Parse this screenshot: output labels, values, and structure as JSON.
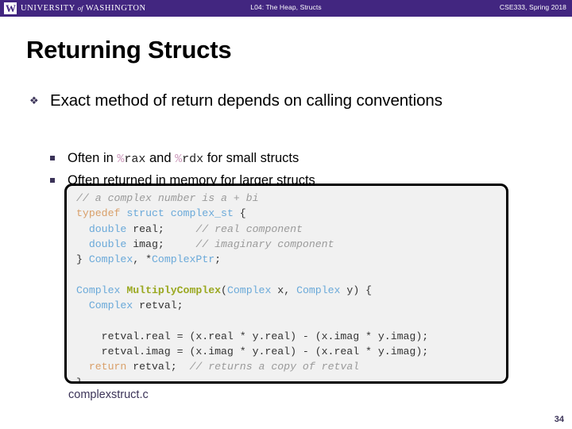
{
  "header": {
    "logo_mark": "W",
    "logo_word_1": "UNIVERSITY",
    "logo_word_of": "of",
    "logo_word_2": "WASHINGTON",
    "center_title": "L04: The Heap, Structs",
    "right_title": "CSE333, Spring 2018",
    "bar_color": "#422680"
  },
  "slide": {
    "title": "Returning Structs",
    "page_number": "34",
    "accent_color": "#3b3358",
    "bullets": [
      {
        "marker": "diamond-bullet",
        "text": "Exact method of return depends on calling conventions"
      }
    ],
    "sub_bullets": [
      {
        "marker": "square-bullet",
        "prefix": "Often in ",
        "code_1_pct": "%",
        "code_1": "rax",
        "middle": " and ",
        "code_2_pct": "%",
        "code_2": "rdx",
        "suffix": " for small structs",
        "plain": "Often in %rax and %rdx for small structs"
      },
      {
        "marker": "square-bullet",
        "plain": "Often returned in memory for larger structs"
      }
    ],
    "caption": "complexstruct.c"
  },
  "code": {
    "language": "c",
    "filename": "complexstruct.c",
    "lines": [
      "// a complex number is a + bi",
      "typedef struct complex_st {",
      "  double real;     // real component",
      "  double imag;     // imaginary component",
      "} Complex, *ComplexPtr;",
      "",
      "Complex MultiplyComplex(Complex x, Complex y) {",
      "  Complex retval;",
      "",
      "  retval.real = (x.real * y.real) - (x.imag * y.imag);",
      "  retval.imag = (x.imag * y.real) - (x.real * y.imag);",
      "  return retval;  // returns a copy of retval",
      "}"
    ],
    "colors": {
      "comment": "#9a9a9a",
      "keyword": "#d9a06a",
      "type": "#6aa9d9",
      "function": "#9aa820",
      "identifier": "#333333",
      "background": "#f1f1f1",
      "border": "#000000"
    }
  }
}
